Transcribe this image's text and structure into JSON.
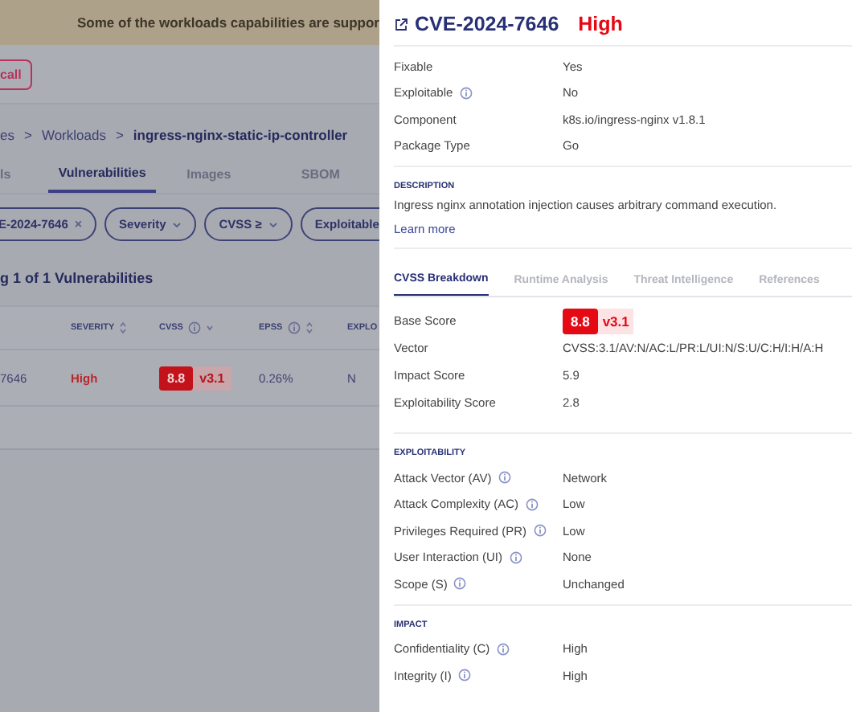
{
  "banner": {
    "text": "Some of the workloads capabilities are suppor"
  },
  "action_button": {
    "label": "call"
  },
  "breadcrumb": {
    "separator": ">",
    "items": [
      "es",
      "Workloads",
      "ingress-nginx-static-ip-controller"
    ]
  },
  "page_tabs": [
    {
      "label": "ls",
      "selected": false
    },
    {
      "label": "Vulnerabilities",
      "selected": true
    },
    {
      "label": "Images",
      "selected": false
    },
    {
      "label": "SBOM",
      "selected": false
    }
  ],
  "filters": [
    {
      "kind": "value",
      "label": "E-2024-7646",
      "remove": "×"
    },
    {
      "kind": "dropdown",
      "label": "Severity"
    },
    {
      "kind": "dropdown",
      "label": "CVSS ≥"
    },
    {
      "kind": "dropdown",
      "label": "Exploitable"
    }
  ],
  "results_title": "g 1 of 1 Vulnerabilities",
  "table": {
    "columns": [
      {
        "label": "SEVERITY",
        "info": false,
        "sortable": true,
        "sorted": false
      },
      {
        "label": "CVSS",
        "info": true,
        "sortable": true,
        "sorted": true
      },
      {
        "label": "EPSS",
        "info": true,
        "sortable": true,
        "sorted": false
      },
      {
        "label": "EXPLO",
        "info": false,
        "sortable": false
      }
    ],
    "rows": [
      {
        "id": "7646",
        "severity": "High",
        "cvss_score": "8.8",
        "cvss_version": "v3.1",
        "epss": "0.26%",
        "exploitable": "N"
      }
    ]
  },
  "drawer": {
    "cve": "CVE-2024-7646",
    "severity": "High",
    "details": [
      {
        "label": "Fixable",
        "value": "Yes",
        "info": false
      },
      {
        "label": "Exploitable",
        "value": "No",
        "info": true
      },
      {
        "label": "Component",
        "value": "k8s.io/ingress-nginx v1.8.1",
        "info": false
      },
      {
        "label": "Package Type",
        "value": "Go",
        "info": false
      }
    ],
    "description": {
      "heading": "DESCRIPTION",
      "text": "Ingress nginx annotation injection causes arbitrary command execution.",
      "link": "Learn more"
    },
    "tabs": [
      {
        "label": "CVSS Breakdown",
        "selected": true
      },
      {
        "label": "Runtime Analysis",
        "selected": false
      },
      {
        "label": "Threat Intelligence",
        "selected": false
      },
      {
        "label": "References",
        "selected": false
      }
    ],
    "scores": [
      {
        "kind": "badge",
        "label": "Base Score",
        "score": "8.8",
        "version": "v3.1"
      },
      {
        "kind": "text",
        "label": "Vector",
        "value": "CVSS:3.1/AV:N/AC:L/PR:L/UI:N/S:U/C:H/I:H/A:H"
      },
      {
        "kind": "text",
        "label": "Impact Score",
        "value": "5.9"
      },
      {
        "kind": "text",
        "label": "Exploitability Score",
        "value": "2.8"
      }
    ],
    "sections": [
      {
        "heading": "EXPLOITABILITY",
        "rows": [
          {
            "label": "Attack Vector (AV)",
            "value": "Network",
            "info": true
          },
          {
            "label": "Attack Complexity (AC)",
            "value": "Low",
            "info": true
          },
          {
            "label": "Privileges Required (PR)",
            "value": "Low",
            "info": true
          },
          {
            "label": "User Interaction (UI)",
            "value": "None",
            "info": true
          },
          {
            "label": "Scope (S)",
            "value": "Unchanged",
            "info": true
          }
        ]
      },
      {
        "heading": "IMPACT",
        "rows": [
          {
            "label": "Confidentiality (C)",
            "value": "High",
            "info": true
          },
          {
            "label": "Integrity (I)",
            "value": "High",
            "info": true
          }
        ]
      }
    ]
  }
}
